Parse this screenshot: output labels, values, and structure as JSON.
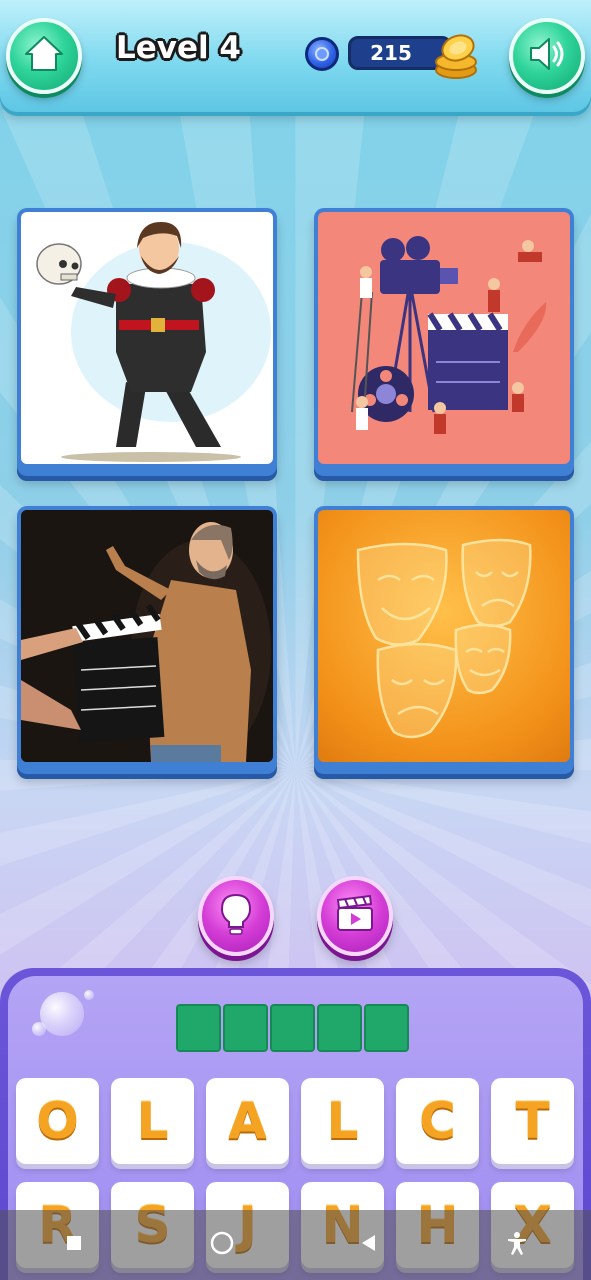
{
  "header": {
    "level_title": "Level 4",
    "coins": "215",
    "icons": {
      "home": "home-icon",
      "gem": "gem-icon",
      "coins": "coin-stack-icon",
      "sound": "speaker-icon"
    }
  },
  "tiles": [
    {
      "subject": "Actor in Elizabethan costume holding a skull"
    },
    {
      "subject": "Film crew with camera, clapperboard and film reel"
    },
    {
      "subject": "Actor on stage with a clapperboard"
    },
    {
      "subject": "Golden comedy and tragedy masks"
    }
  ],
  "actions": {
    "hint_icon": "lightbulb-icon",
    "video_icon": "video-clapper-icon"
  },
  "answer": {
    "length": 5,
    "slots": [
      "",
      "",
      "",
      "",
      ""
    ]
  },
  "letters": [
    "O",
    "L",
    "A",
    "L",
    "C",
    "T",
    "R",
    "S",
    "J",
    "N",
    "H",
    "X"
  ],
  "navbar": {
    "icons": [
      "square-icon",
      "circle-home-icon",
      "triangle-back-icon",
      "accessibility-icon"
    ]
  },
  "colors": {
    "header_bg": "#7fd9ef",
    "green_button": "#2fd49b",
    "purple_button": "#d43dd6",
    "panel_bg": "#6b55d8",
    "answer_slot": "#1fa86a",
    "letter_text": "#f5a323",
    "tile_frame": "#3f7fd4"
  }
}
